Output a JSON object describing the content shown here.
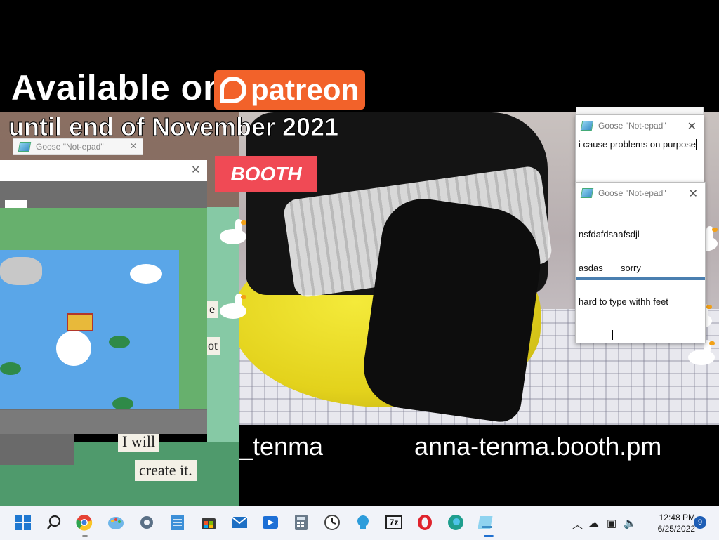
{
  "stream": {
    "patreon_line": "Available on",
    "patreon_brand": "patreon",
    "until_line": "until end of November 2021",
    "booth_label": "BOOTH",
    "promo_left": "_tenma",
    "promo_right": "anna-tenma.booth.pm"
  },
  "game_notes": {
    "note1": "e",
    "note2": "ot",
    "note3": "I will",
    "note4": "create it."
  },
  "notepads": {
    "ghost_title": "Goose \"Not-epad\"",
    "top": {
      "title": "Goose \"Not-epad\"",
      "text": "i cause problems on purpose"
    },
    "bottom": {
      "title": "Goose \"Not-epad\"",
      "lines": [
        "nsfdafdsaafsdjl",
        "asdas       sorry",
        "hard to type withh feet"
      ]
    }
  },
  "taskbar": {
    "icons": [
      "windows-start-icon",
      "search-icon",
      "chrome-icon",
      "paint-icon",
      "settings-icon",
      "notepad-icon",
      "store-icon",
      "mail-icon",
      "media-player-icon",
      "calculator-icon",
      "clock-icon",
      "tips-icon",
      "7zip-icon",
      "opera-icon",
      "edge-icon",
      "goose-notepad-icon"
    ],
    "time": "12:48 PM",
    "date": "6/25/2022",
    "notification_count": "9",
    "zip_label": "7z"
  },
  "colors": {
    "patreon": "#f2622a",
    "booth": "#f04a55",
    "taskbar": "#f1f3f9",
    "accent": "#1f5eb5"
  }
}
